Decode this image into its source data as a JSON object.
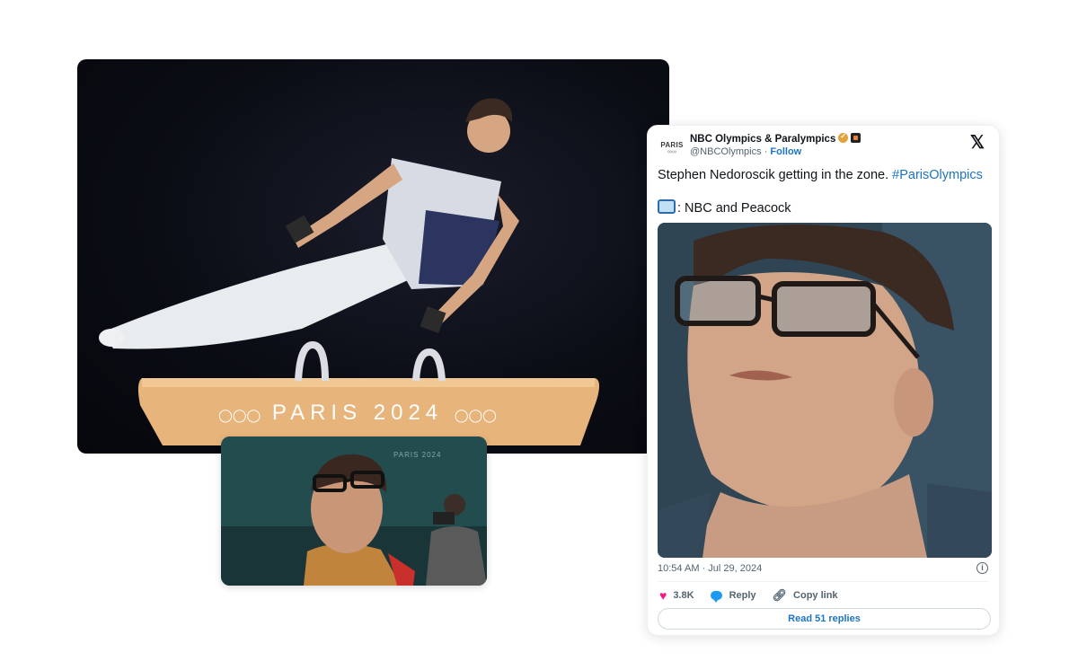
{
  "main_photo": {
    "pommel_text": "PARIS 2024"
  },
  "sub_photo": {
    "background_text": "PARIS 2024"
  },
  "tweet": {
    "author_name": "NBC Olympics & Paralympics",
    "avatar_text": "PARIS",
    "handle": "@NBCOlympics",
    "separator": " · ",
    "follow_label": "Follow",
    "x_logo": "𝕏",
    "text_main": "Stephen Nedoroscik getting in the zone. ",
    "hashtag": "#ParisOlympics",
    "text_line2": ": NBC and Peacock",
    "timestamp": "10:54 AM · Jul 29, 2024",
    "info_label": "i",
    "likes": "3.8K",
    "reply_label": "Reply",
    "copy_link_label": "Copy link",
    "read_replies_label": "Read 51 replies",
    "colors": {
      "link": "#1d74c2",
      "heart": "#f91880",
      "reply": "#1d9bf0"
    },
    "icons": [
      "x-logo-icon",
      "verified-icon",
      "affiliate-icon",
      "tv-icon",
      "info-icon",
      "heart-icon",
      "reply-icon",
      "link-icon"
    ]
  }
}
